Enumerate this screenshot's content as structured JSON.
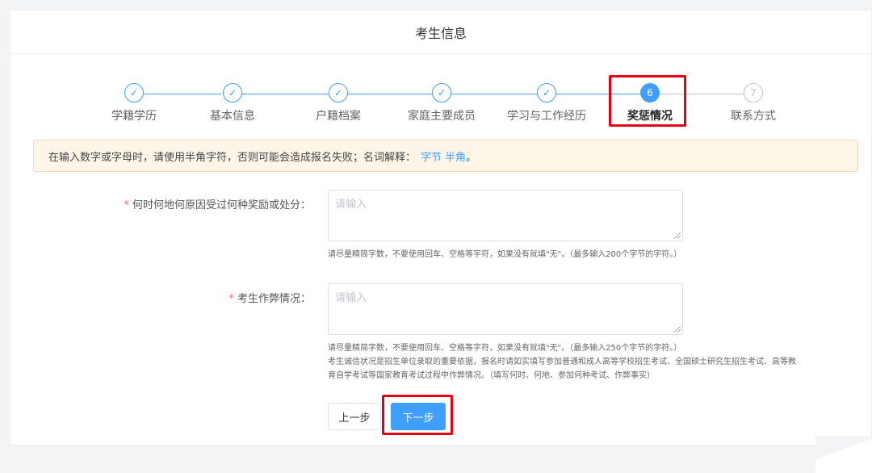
{
  "header": {
    "title": "考生信息"
  },
  "steps": [
    {
      "index": "1",
      "label": "学籍学历",
      "status": "done"
    },
    {
      "index": "2",
      "label": "基本信息",
      "status": "done"
    },
    {
      "index": "3",
      "label": "户籍档案",
      "status": "done"
    },
    {
      "index": "4",
      "label": "家庭主要成员",
      "status": "done"
    },
    {
      "index": "5",
      "label": "学习与工作经历",
      "status": "done"
    },
    {
      "index": "6",
      "label": "奖惩情况",
      "status": "active"
    },
    {
      "index": "7",
      "label": "联系方式",
      "status": "pending"
    }
  ],
  "alert": {
    "text": "在输入数字或字母时，请使用半角字符，否则可能会造成报名失败；名词解释：",
    "link_bytes": "字节",
    "link_halfwidth": "半角",
    "end": "。"
  },
  "form": {
    "required_mark": "*",
    "field1": {
      "label": "何时何地何原因受过何种奖励或处分：",
      "placeholder": "请输入",
      "hint": "请尽量精简字数，不要使用回车、空格等字符，如果没有就填\"无\"。（最多输入200个字节的字符。）"
    },
    "field2": {
      "label": "考生作弊情况：",
      "placeholder": "请输入",
      "hint1": "请尽量精简字数，不要使用回车、空格等字符，如果没有就填\"无\"。（最多输入250个字节的字符。）",
      "hint2": "考生诚信状况是招生单位录取的重要依据，报名时请如实填写参加普通和成人高等学校招生考试、全国硕士研究生招生考试、高等教育自学考试等国家教育考试过程中作弊情况。（填写何时、何地、参加何种考试、作弊事实）"
    }
  },
  "buttons": {
    "prev": "上一步",
    "next": "下一步"
  },
  "colors": {
    "primary": "#409eff",
    "highlight": "#e60012",
    "required": "#f56c6c"
  }
}
